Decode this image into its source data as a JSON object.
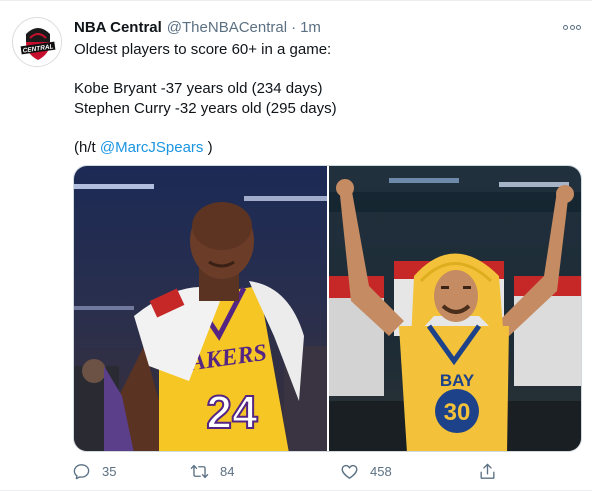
{
  "tweet": {
    "display_name": "NBA Central",
    "handle": "@TheNBACentral",
    "separator": "·",
    "time": "1m",
    "avatar_text": "CENTRAL",
    "lines": {
      "l1": "Oldest players to score 60+ in a game:",
      "l2": "Kobe Bryant -37 years old (234 days)",
      "l3": "Stephen Curry -32 years old (295 days)",
      "ht_prefix": "(h/t ",
      "ht_mention": "@MarcJSpears",
      "ht_suffix": " )"
    },
    "photos": {
      "left": {
        "team_text": "LAKERS",
        "number": "24"
      },
      "right": {
        "team_text": "BAY",
        "number": "30"
      }
    },
    "actions": {
      "replies": "35",
      "retweets": "84",
      "likes": "458"
    }
  },
  "colors": {
    "link": "#1b95e0",
    "secondary": "#5b7083",
    "lakers_gold": "#f6c624",
    "lakers_purple": "#552583",
    "warriors_gold": "#f3c23a",
    "warriors_blue": "#1d428a"
  },
  "icons": [
    "more-icon",
    "reply-icon",
    "retweet-icon",
    "like-icon",
    "share-icon"
  ]
}
